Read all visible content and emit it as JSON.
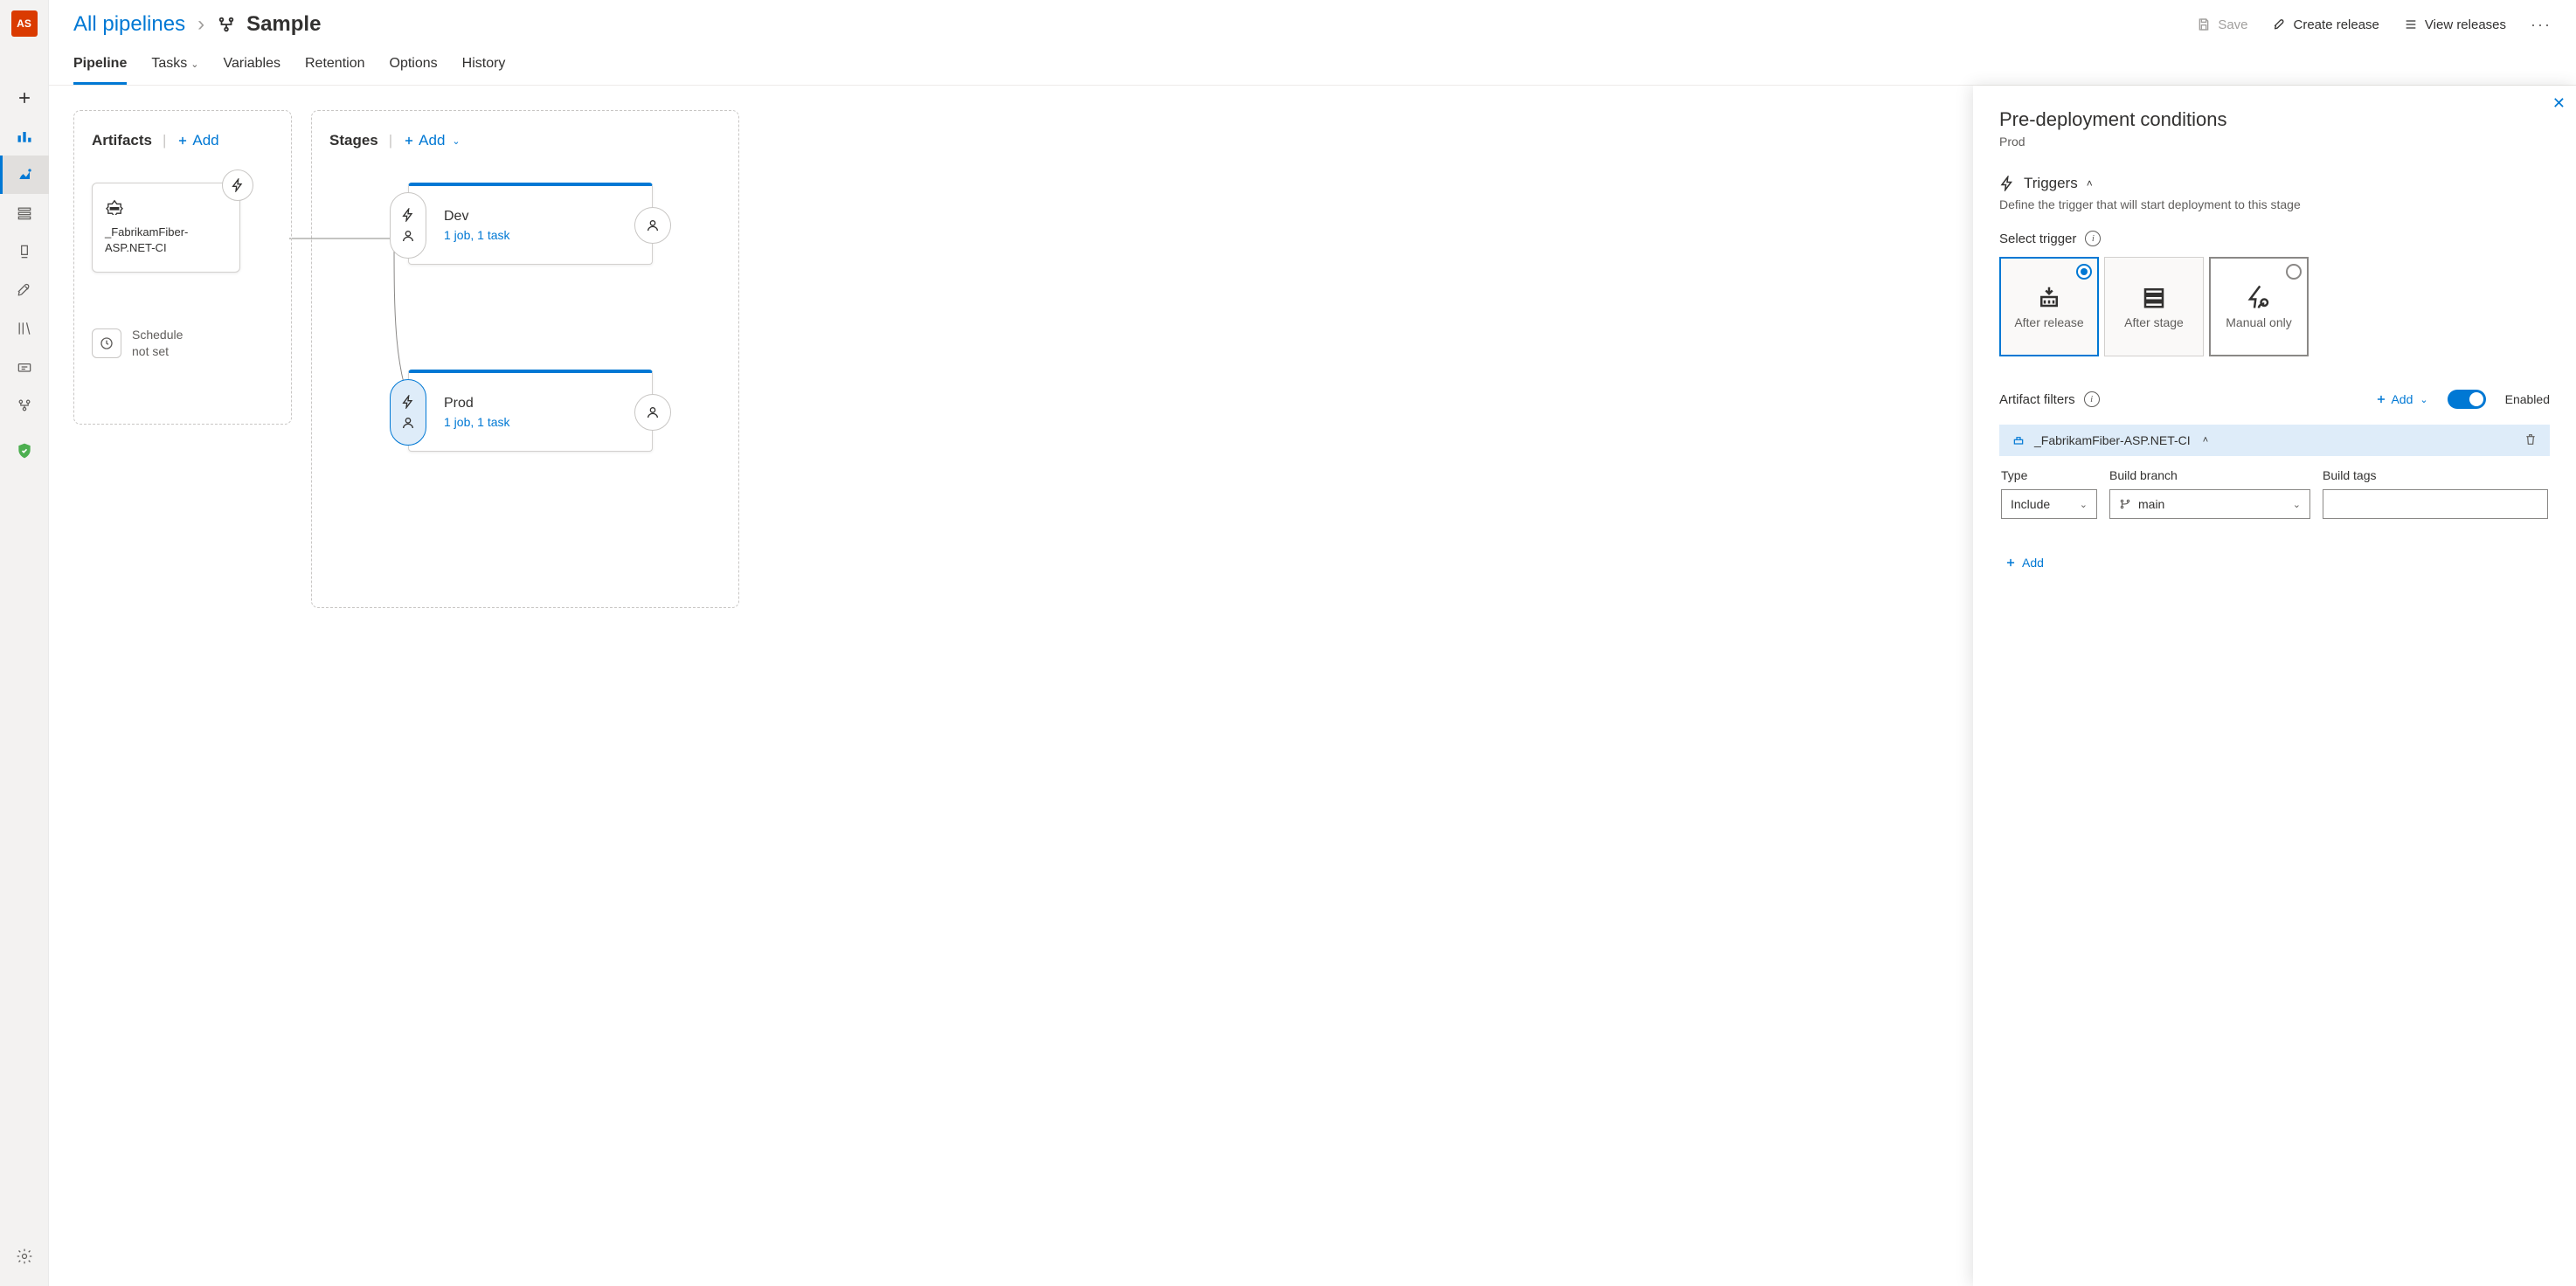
{
  "rail_avatar": "AS",
  "breadcrumb": {
    "root": "All pipelines",
    "title": "Sample"
  },
  "header_actions": {
    "save": "Save",
    "create_release": "Create release",
    "view_releases": "View releases"
  },
  "tabs": {
    "pipeline": "Pipeline",
    "tasks": "Tasks",
    "variables": "Variables",
    "retention": "Retention",
    "options": "Options",
    "history": "History"
  },
  "artifacts": {
    "title": "Artifacts",
    "add": "Add",
    "card_name": "_FabrikamFiber-ASP.NET-CI",
    "schedule_label": "Schedule not set"
  },
  "stages": {
    "title": "Stages",
    "add": "Add",
    "items": [
      {
        "name": "Dev",
        "sub": "1 job, 1 task"
      },
      {
        "name": "Prod",
        "sub": "1 job, 1 task"
      }
    ]
  },
  "panel": {
    "title": "Pre-deployment conditions",
    "stage": "Prod",
    "triggers": {
      "title": "Triggers",
      "desc": "Define the trigger that will start deployment to this stage",
      "select_label": "Select trigger",
      "options": {
        "after_release": "After release",
        "after_stage": "After stage",
        "manual_only": "Manual only"
      }
    },
    "artifact_filters": {
      "title": "Artifact filters",
      "add": "Add",
      "enabled_label": "Enabled",
      "source": "_FabrikamFiber-ASP.NET-CI",
      "columns": {
        "type": "Type",
        "branch": "Build branch",
        "tags": "Build tags"
      },
      "row": {
        "type": "Include",
        "branch": "main"
      },
      "add_row": "Add"
    }
  }
}
